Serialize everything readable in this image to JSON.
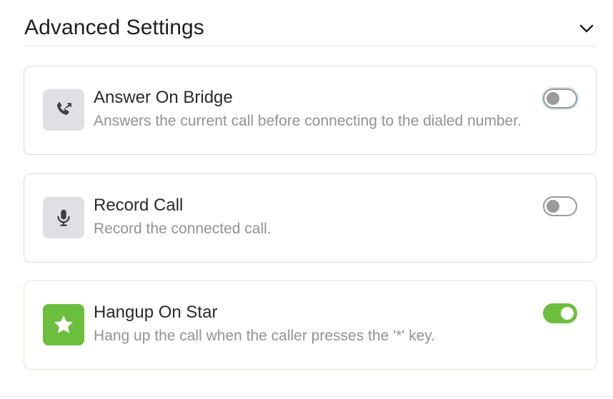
{
  "section": {
    "title": "Advanced Settings",
    "collapse_icon": "chevron-down-icon"
  },
  "settings": [
    {
      "title": "Answer On Bridge",
      "description": "Answers the current call before connecting to the dialed number.",
      "icon": "phone-forward-icon",
      "enabled": false
    },
    {
      "title": "Record Call",
      "description": "Record the connected call.",
      "icon": "microphone-icon",
      "enabled": false
    },
    {
      "title": "Hangup On Star",
      "description": "Hang up the call when the caller presses the '*' key.",
      "icon": "star-icon",
      "enabled": true
    }
  ],
  "colors": {
    "accent_green": "#6cbf3c",
    "toggle_off": "#9a9a9a",
    "icon_bg": "#dee0e3"
  }
}
